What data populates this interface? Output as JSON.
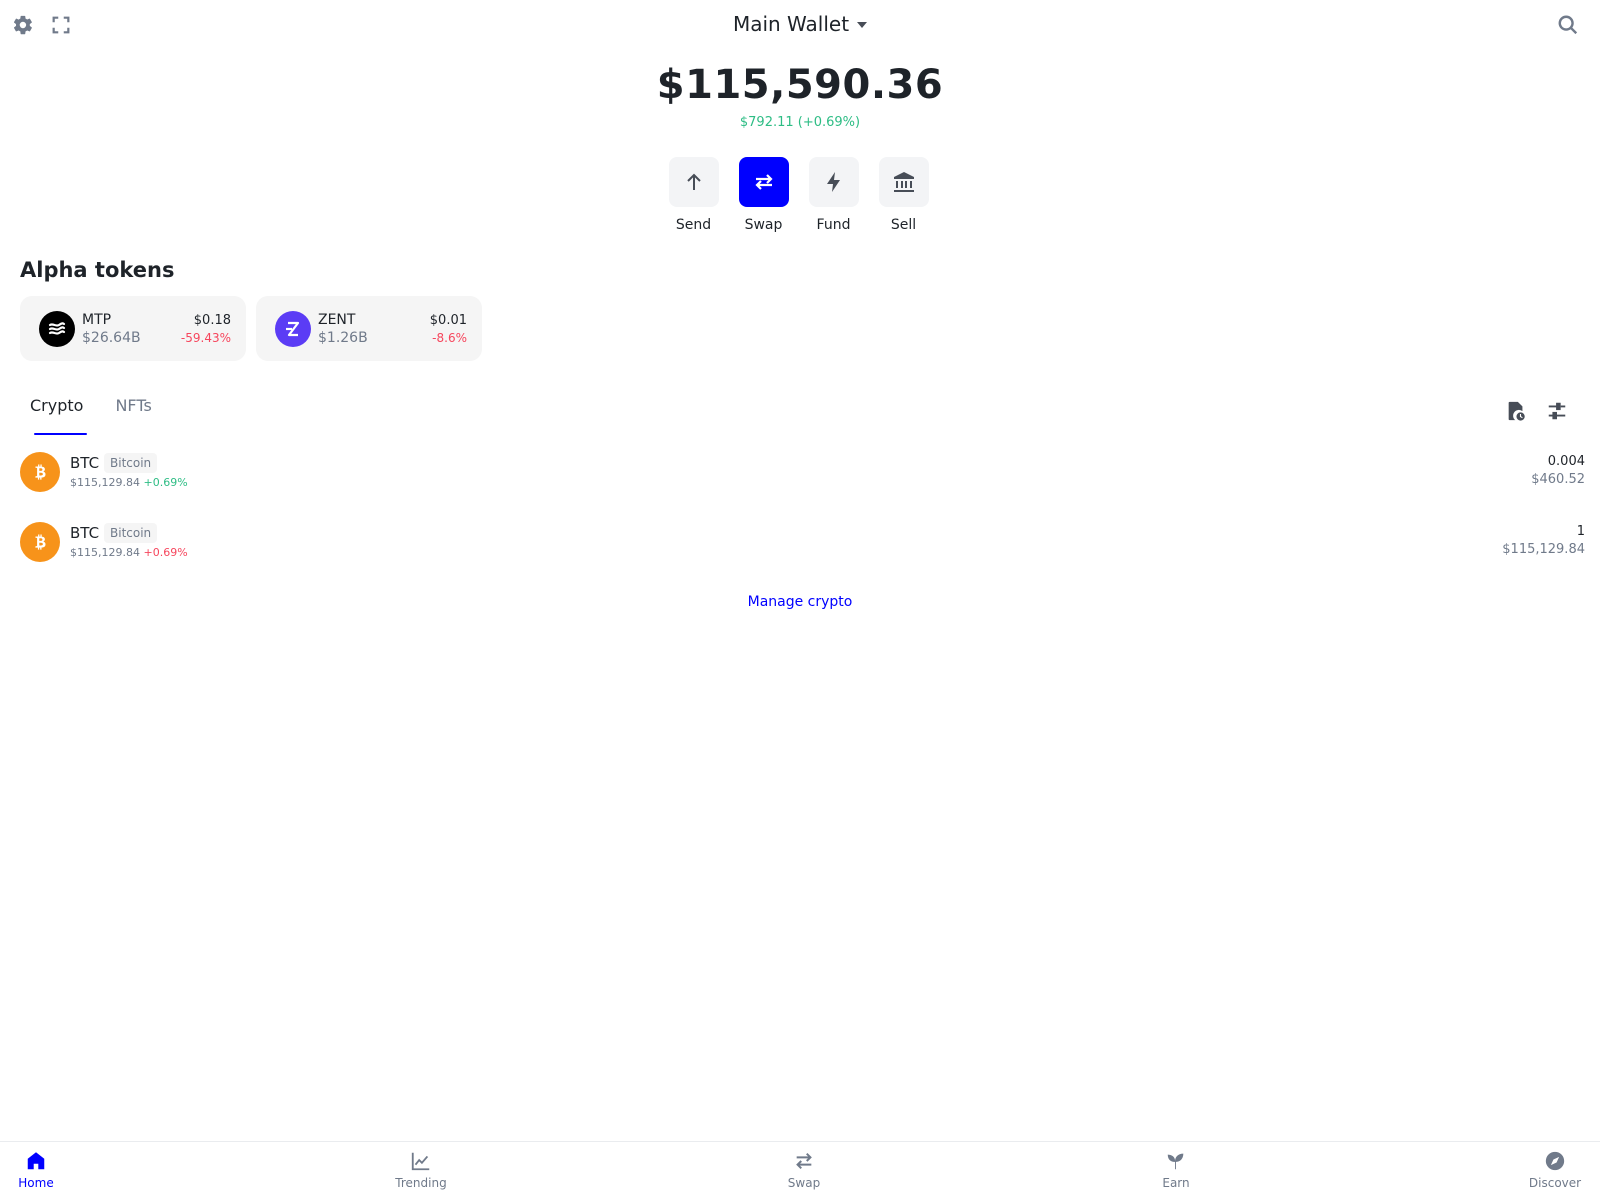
{
  "header": {
    "wallet_title": "Main Wallet",
    "icons": [
      "gear-icon",
      "fullscreen-icon",
      "search-icon"
    ]
  },
  "balance": {
    "total": "$115,590.36",
    "change": "$792.11 (+0.69%)"
  },
  "actions": [
    {
      "label": "Send",
      "icon": "arrow-up-icon"
    },
    {
      "label": "Swap",
      "icon": "swap-icon"
    },
    {
      "label": "Fund",
      "icon": "lightning-icon"
    },
    {
      "label": "Sell",
      "icon": "bank-icon"
    }
  ],
  "alpha": {
    "title": "Alpha tokens",
    "tokens": [
      {
        "symbol": "MTP",
        "market_cap": "$26.64B",
        "price": "$0.18",
        "change": "-59.43%"
      },
      {
        "symbol": "ZENT",
        "market_cap": "$1.26B",
        "price": "$0.01",
        "change": "-8.6%"
      }
    ]
  },
  "tabs": {
    "crypto": "Crypto",
    "nfts": "NFTs",
    "active": "Crypto"
  },
  "assets": [
    {
      "symbol": "BTC",
      "name": "Bitcoin",
      "price": "$115,129.84",
      "change": "+0.69%",
      "change_color": "#2ebd85",
      "quantity": "0.004",
      "value": "$460.52"
    },
    {
      "symbol": "BTC",
      "name": "Bitcoin",
      "price": "$115,129.84",
      "change": "+0.69%",
      "change_color": "#f6465d",
      "quantity": "1",
      "value": "$115,129.84"
    }
  ],
  "manage_label": "Manage crypto",
  "nav": {
    "active": "Home",
    "items": [
      {
        "label": "Home",
        "icon": "home-icon"
      },
      {
        "label": "Trending",
        "icon": "chart-icon"
      },
      {
        "label": "Swap",
        "icon": "swap-icon"
      },
      {
        "label": "Earn",
        "icon": "sprout-icon"
      },
      {
        "label": "Discover",
        "icon": "compass-icon"
      }
    ]
  },
  "colors": {
    "accent": "#0000ff",
    "positive": "#2ebd85",
    "negative": "#f6465d",
    "bitcoin": "#f7931a"
  }
}
